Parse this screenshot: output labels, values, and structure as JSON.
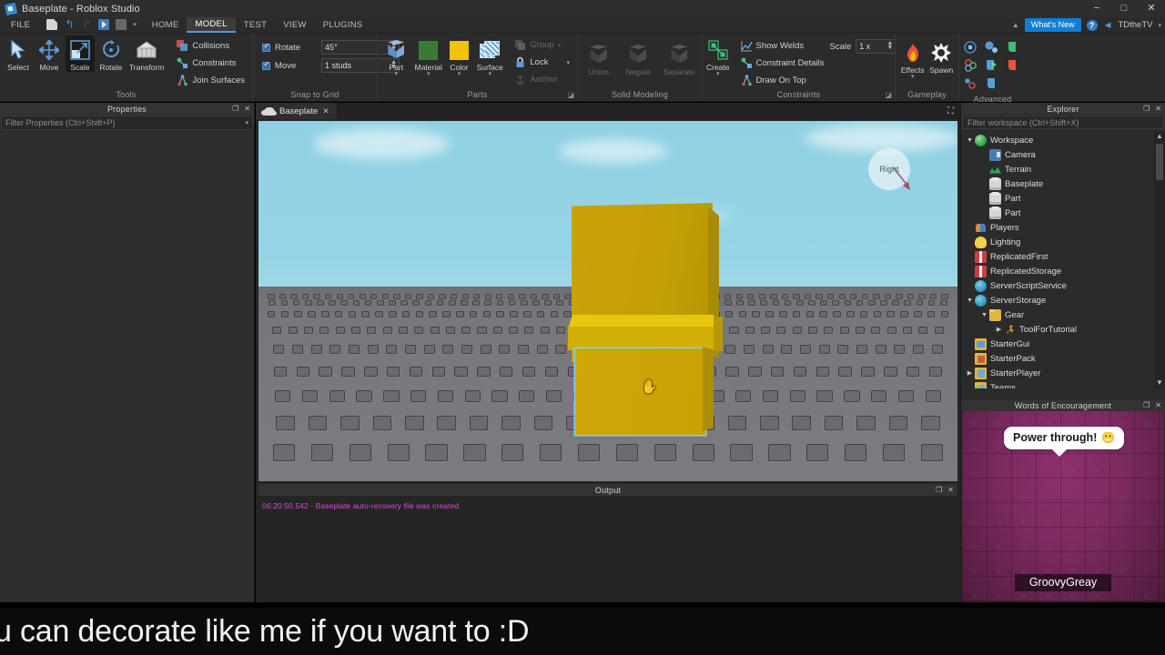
{
  "window": {
    "title": "Baseplate - Roblox Studio",
    "minimize": "−",
    "maximize": "□",
    "close": "✕"
  },
  "menubar": {
    "file": "FILE",
    "quick_access": [
      {
        "name": "new-document-icon",
        "glyph": "newdoc"
      },
      {
        "name": "undo-icon",
        "glyph": "↰"
      },
      {
        "name": "redo-icon",
        "glyph": "↱"
      },
      {
        "name": "play-icon",
        "glyph": "play"
      },
      {
        "name": "stop-icon",
        "glyph": "stop"
      },
      {
        "name": "quick-access-caret-icon",
        "glyph": "▾"
      }
    ],
    "tabs": [
      {
        "label": "HOME",
        "active": false
      },
      {
        "label": "MODEL",
        "active": true
      },
      {
        "label": "TEST",
        "active": false
      },
      {
        "label": "VIEW",
        "active": false
      },
      {
        "label": "PLUGINS",
        "active": false
      }
    ],
    "collapse_caret": "▲",
    "whats_new": "What's New",
    "help": "?",
    "share": "◄",
    "user": "TDtheTV",
    "user_caret": "▾"
  },
  "ribbon": {
    "tools": {
      "label": "Tools",
      "buttons": [
        {
          "label": "Select",
          "selected": false
        },
        {
          "label": "Move",
          "selected": false
        },
        {
          "label": "Scale",
          "selected": true
        },
        {
          "label": "Rotate",
          "selected": false
        },
        {
          "label": "Transform",
          "selected": false
        }
      ],
      "toggles": [
        {
          "label": "Collisions",
          "checked": true
        },
        {
          "label": "Constraints",
          "checked": true
        },
        {
          "label": "Join Surfaces",
          "checked": false
        }
      ]
    },
    "snap": {
      "label": "Snap to Grid",
      "rotate_label": "Rotate",
      "rotate_value": "45°",
      "move_label": "Move",
      "move_value": "1 studs"
    },
    "parts": {
      "label": "Parts",
      "buttons": [
        {
          "label": "Part",
          "dropdown": true
        },
        {
          "label": "Material",
          "dropdown": true
        },
        {
          "label": "Color",
          "dropdown": true
        },
        {
          "label": "Surface",
          "dropdown": true
        }
      ],
      "small": [
        {
          "label": "Group",
          "disabled": true,
          "dropdown": true
        },
        {
          "label": "Lock",
          "disabled": false,
          "dropdown": true
        },
        {
          "label": "Anchor",
          "disabled": true,
          "dropdown": false
        }
      ]
    },
    "solid_modeling": {
      "label": "Solid Modeling",
      "buttons": [
        {
          "label": "Union",
          "disabled": true
        },
        {
          "label": "Negate",
          "disabled": true
        },
        {
          "label": "Separate",
          "disabled": true
        }
      ]
    },
    "constraints": {
      "label": "Constraints",
      "create_label": "Create",
      "items": [
        {
          "label": "Show Welds"
        },
        {
          "label": "Constraint Details"
        },
        {
          "label": "Draw On Top"
        }
      ],
      "scale_label": "Scale",
      "scale_value": "1 x"
    },
    "gameplay": {
      "label": "Gameplay",
      "buttons": [
        {
          "label": "Effects",
          "dropdown": true
        },
        {
          "label": "Spawn",
          "dropdown": false
        }
      ]
    },
    "advanced": {
      "label": "Advanced"
    }
  },
  "properties": {
    "title": "Properties",
    "filter_placeholder": "Filter Properties (Ctrl+Shift+P)",
    "undock": "❐",
    "close": "✕"
  },
  "document_tab": {
    "name": "Baseplate",
    "close": "✕",
    "expand": "⛶"
  },
  "viewport": {
    "navcube_face": "Right"
  },
  "output": {
    "title": "Output",
    "undock": "❐",
    "close": "✕",
    "lines": [
      "06:20:50.542 - Baseplate auto-recovery file was created"
    ]
  },
  "explorer": {
    "title": "Explorer",
    "undock": "❐",
    "close": "✕",
    "filter_placeholder": "Filter workspace (Ctrl+Shift+X)",
    "scroll_up": "▲",
    "scroll_down": "▼",
    "nodes": [
      {
        "label": "Workspace",
        "indent": 0,
        "arrow": "v",
        "icon": "ic-globe"
      },
      {
        "label": "Camera",
        "indent": 1,
        "arrow": "",
        "icon": "ic-camera"
      },
      {
        "label": "Terrain",
        "indent": 1,
        "arrow": "",
        "icon": "ic-terrain"
      },
      {
        "label": "Baseplate",
        "indent": 1,
        "arrow": "",
        "icon": "ic-brick"
      },
      {
        "label": "Part",
        "indent": 1,
        "arrow": "",
        "icon": "ic-brick"
      },
      {
        "label": "Part",
        "indent": 1,
        "arrow": "",
        "icon": "ic-brick"
      },
      {
        "label": "Players",
        "indent": 0,
        "arrow": "",
        "icon": "ic-players"
      },
      {
        "label": "Lighting",
        "indent": 0,
        "arrow": "",
        "icon": "ic-light"
      },
      {
        "label": "ReplicatedFirst",
        "indent": 0,
        "arrow": "",
        "icon": "ic-gift"
      },
      {
        "label": "ReplicatedStorage",
        "indent": 0,
        "arrow": "",
        "icon": "ic-gift"
      },
      {
        "label": "ServerScriptService",
        "indent": 0,
        "arrow": "",
        "icon": "ic-script"
      },
      {
        "label": "ServerStorage",
        "indent": 0,
        "arrow": "v",
        "icon": "ic-script"
      },
      {
        "label": "Gear",
        "indent": 1,
        "arrow": "v",
        "icon": "ic-folder"
      },
      {
        "label": "ToolForTutorial",
        "indent": 2,
        "arrow": ">",
        "icon": "ic-tool"
      },
      {
        "label": "StarterGui",
        "indent": 0,
        "arrow": "",
        "icon": "ic-gui"
      },
      {
        "label": "StarterPack",
        "indent": 0,
        "arrow": "",
        "icon": "ic-pack"
      },
      {
        "label": "StarterPlayer",
        "indent": 0,
        "arrow": ">",
        "icon": "ic-player"
      },
      {
        "label": "Teams",
        "indent": 0,
        "arrow": "",
        "icon": "ic-teams"
      }
    ]
  },
  "words_of_encouragement": {
    "title": "Words of Encouragement",
    "undock": "❐",
    "close": "✕",
    "bubble_text": "Power through!",
    "bubble_emoji": "😬",
    "username": "GroovyGreay"
  },
  "subtitle": {
    "text": "u can decorate like me if you want to :D"
  },
  "colors": {
    "accent": "#0f7fd4",
    "ribbon_bg": "#2b2b2b",
    "part_yellow": "#c9a207",
    "selection_outline": "#7fd7ea",
    "output_text": "#d44fd4",
    "woe_bg": "#7a2a5e"
  }
}
